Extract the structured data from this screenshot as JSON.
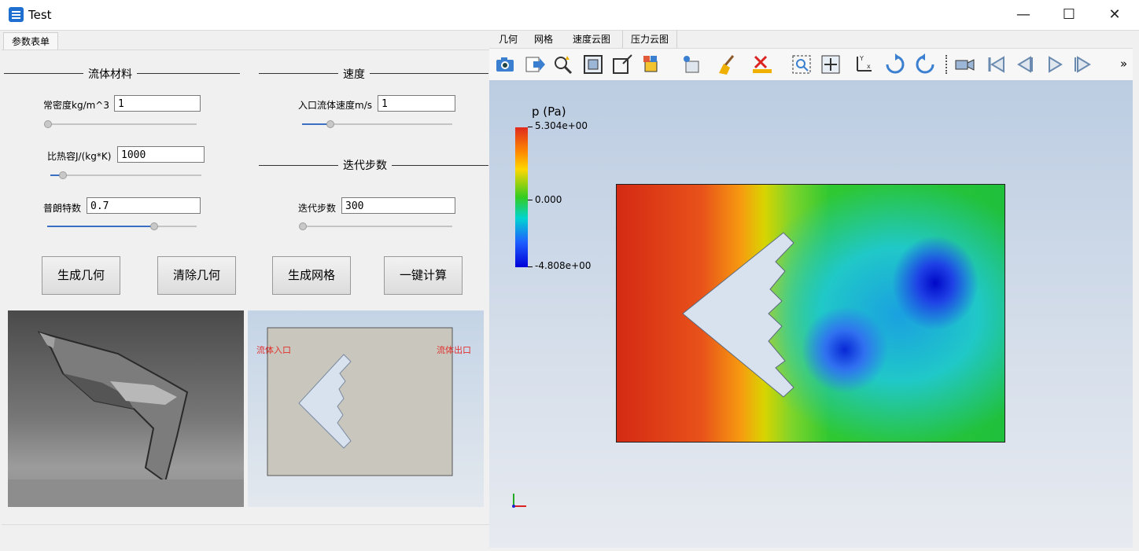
{
  "window": {
    "title": "Test"
  },
  "left": {
    "tab": "参数表单",
    "fluid_group": "流体材料",
    "speed_group": "速度",
    "iter_group": "迭代步数",
    "density_label": "常密度kg/m^3",
    "density_value": "1",
    "heat_label": "比热容J/(kg*K)",
    "heat_value": "1000",
    "prandtl_label": "普朗特数",
    "prandtl_value": "0.7",
    "inlet_label": "入口流体速度m/s",
    "inlet_value": "1",
    "steps_label": "迭代步数",
    "steps_value": "300",
    "sliders": {
      "density": 0.0,
      "heat": 0.08,
      "prandtl": 0.7,
      "inlet": 0.2,
      "steps": 0.0
    },
    "buttons": {
      "gen_geom": "生成几何",
      "clear_geom": "清除几何",
      "gen_mesh": "生成网格",
      "compute": "一键计算"
    },
    "geom_view": {
      "inlet": "流体入口",
      "outlet": "流体出口"
    }
  },
  "right": {
    "menu": [
      "几何",
      "网格",
      "速度云图",
      "压力云图"
    ],
    "toolbar_icons": [
      "camera-icon",
      "export-icon",
      "query-icon",
      "reset-zoom-icon",
      "box-icon",
      "select-cells-icon",
      "select-points-icon",
      "clear-icon",
      "delete-icon",
      "zoom-box-icon",
      "pan-icon",
      "axes-icon",
      "rotate-cw-icon",
      "rotate-ccw-icon",
      "video-icon",
      "first-frame-icon",
      "prev-frame-icon",
      "play-icon",
      "last-frame-icon"
    ],
    "overflow": "»",
    "legend": {
      "title": "p (Pa)",
      "max": "5.304e+00",
      "mid": "0.000",
      "min": "-4.808e+00"
    },
    "colors": {
      "high": "#e02a1e",
      "mid": "#33cc22",
      "low": "#0000d8"
    }
  }
}
